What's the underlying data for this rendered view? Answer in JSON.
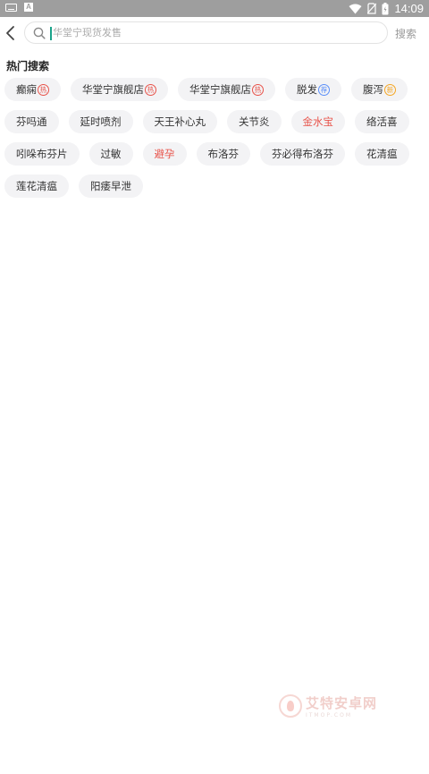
{
  "status_bar": {
    "time": "14:09",
    "left_icons": [
      "keyboard-icon",
      "a-notification-icon"
    ],
    "right_icons": [
      "wifi-icon",
      "no-sim-icon",
      "battery-icon"
    ]
  },
  "search": {
    "placeholder": "华堂宁现货发售",
    "value": "",
    "button_label": "搜索",
    "accent_color": "#1aa38a"
  },
  "hot_search": {
    "title": "热门搜索",
    "rows": [
      [
        {
          "label": "癫痫",
          "badge": "热",
          "badge_color": "#e8534a"
        },
        {
          "label": "华堂宁旗舰店",
          "badge": "热",
          "badge_color": "#e8534a"
        },
        {
          "label": "华堂宁旗舰店",
          "badge": "热",
          "badge_color": "#e8534a"
        },
        {
          "label": "脱发",
          "badge": "荐",
          "badge_color": "#5b8ff9"
        },
        {
          "label": "腹泻",
          "badge": "新",
          "badge_color": "#f5a623"
        }
      ],
      [
        {
          "label": "芬吗通"
        },
        {
          "label": "延时喷剂"
        },
        {
          "label": "天王补心丸"
        },
        {
          "label": "关节炎"
        },
        {
          "label": "金水宝",
          "highlight": true
        },
        {
          "label": "络活喜"
        }
      ],
      [
        {
          "label": "吲哚布芬片"
        },
        {
          "label": "过敏"
        },
        {
          "label": "避孕",
          "highlight": true
        },
        {
          "label": "布洛芬"
        },
        {
          "label": "芬必得布洛芬"
        },
        {
          "label": "花清瘟"
        }
      ],
      [
        {
          "label": "莲花清瘟"
        },
        {
          "label": "阳痿早泄"
        }
      ]
    ]
  },
  "watermark": {
    "text": "艾特安卓网",
    "subtext": "ITMOP.COM"
  }
}
